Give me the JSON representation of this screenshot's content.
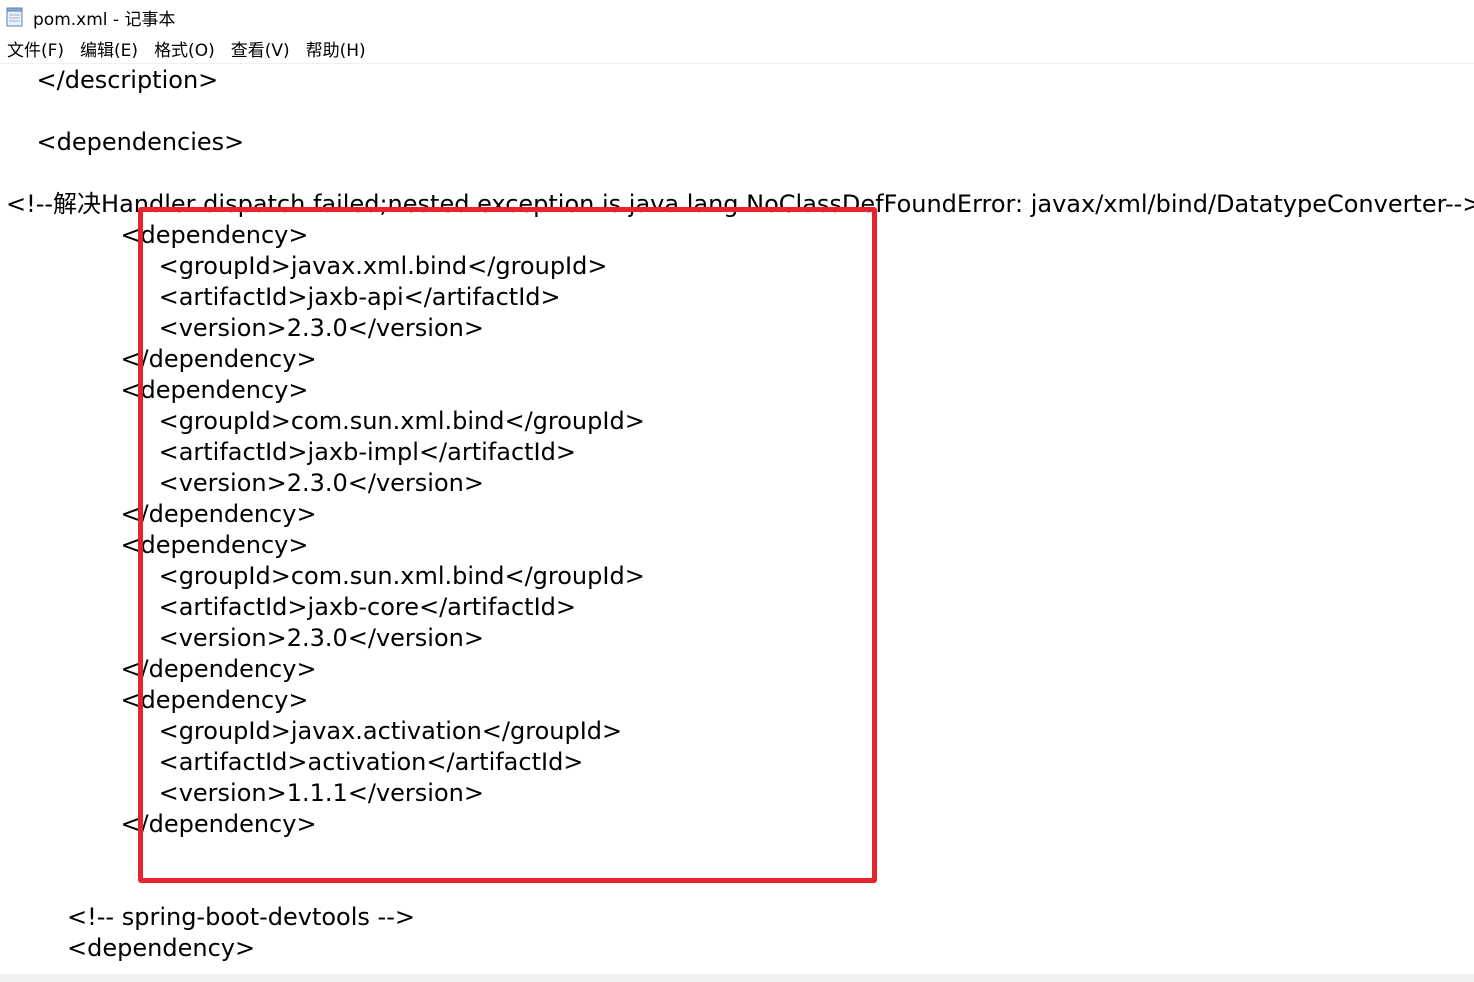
{
  "window": {
    "title": "pom.xml - 记事本",
    "icon": "notepad-icon"
  },
  "menu": {
    "items": [
      "文件(F)",
      "编辑(E)",
      "格式(O)",
      "查看(V)",
      "帮助(H)"
    ]
  },
  "editor": {
    "lines": [
      "    </description>",
      "",
      "    <dependencies>",
      "",
      "<!--解决Handler dispatch failed;nested exception is java.lang.NoClassDefFoundError: javax/xml/bind/DatatypeConverter-->",
      "\t\t\t<dependency>",
      "\t\t\t\t<groupId>javax.xml.bind</groupId>",
      "\t\t\t\t<artifactId>jaxb-api</artifactId>",
      "\t\t\t\t<version>2.3.0</version>",
      "\t\t\t</dependency>",
      "\t\t\t<dependency>",
      "\t\t\t\t<groupId>com.sun.xml.bind</groupId>",
      "\t\t\t\t<artifactId>jaxb-impl</artifactId>",
      "\t\t\t\t<version>2.3.0</version>",
      "\t\t\t</dependency>",
      "\t\t\t<dependency>",
      "\t\t\t\t<groupId>com.sun.xml.bind</groupId>",
      "\t\t\t\t<artifactId>jaxb-core</artifactId>",
      "\t\t\t\t<version>2.3.0</version>",
      "\t\t\t</dependency>",
      "\t\t\t<dependency>",
      "\t\t\t\t<groupId>javax.activation</groupId>",
      "\t\t\t\t<artifactId>activation</artifactId>",
      "\t\t\t\t<version>1.1.1</version>",
      "\t\t\t</dependency>",
      "",
      "",
      "        <!-- spring-boot-devtools -->",
      "        <dependency>"
    ]
  },
  "highlight": {
    "color": "#e8232e"
  }
}
